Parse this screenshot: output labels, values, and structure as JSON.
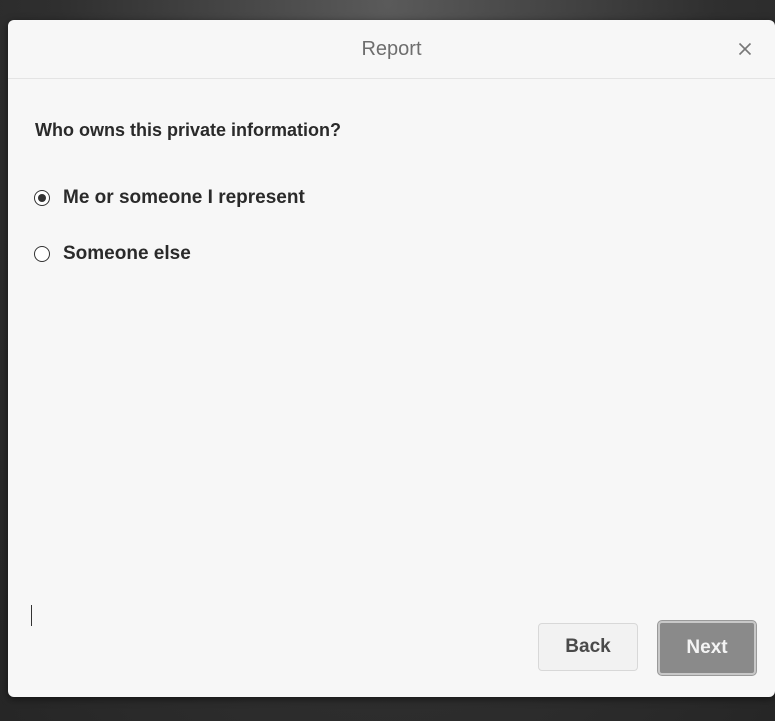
{
  "dialog": {
    "title": "Report",
    "close_icon": "close-icon",
    "question": "Who owns this private information?",
    "options": [
      {
        "label": "Me or someone I represent",
        "selected": true
      },
      {
        "label": "Someone else",
        "selected": false
      }
    ],
    "buttons": {
      "back_label": "Back",
      "next_label": "Next"
    }
  },
  "colors": {
    "dialog_background": "#f7f7f7",
    "next_button": "#8a8a8a",
    "back_button": "#f2f2f2",
    "backdrop": "#2f2f2f"
  }
}
